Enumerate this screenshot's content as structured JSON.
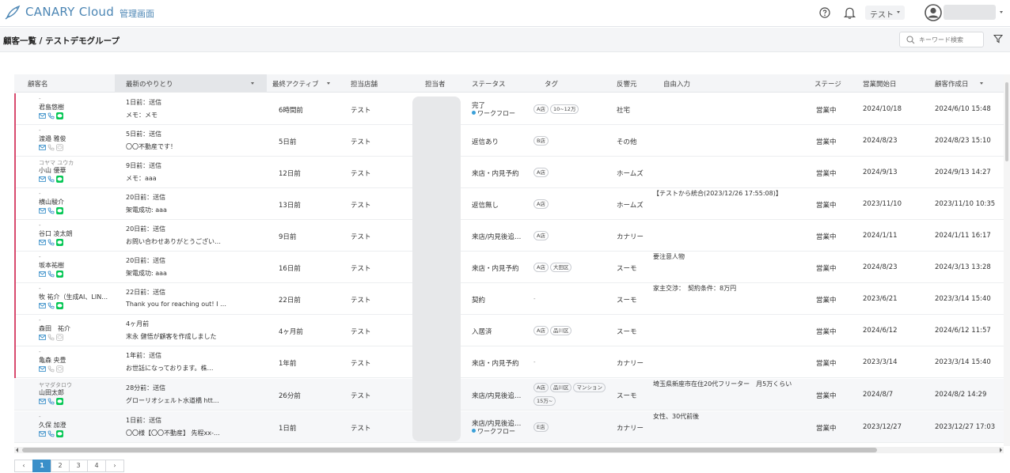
{
  "header": {
    "brand": "CANARY Cloud",
    "admin_label": "管理画面",
    "user_menu_label": "テスト",
    "accent_color": "#4c86b4"
  },
  "subheader": {
    "breadcrumb": "顧客一覧 / テストデモグループ",
    "search_placeholder": "キーワード検索"
  },
  "table": {
    "columns": [
      "顧客名",
      "最新のやりとり",
      "最終アクティブ",
      "担当店舗",
      "担当者",
      "ステータス",
      "タグ",
      "反響元",
      "自由入力",
      "ステージ",
      "営業開始日",
      "顧客作成日"
    ],
    "rows": [
      {
        "kana": "-",
        "name": "君島悠樹",
        "line1": "1日前：送信",
        "line2": "メモ：メモ",
        "active": "6時間前",
        "store": "テスト",
        "status": "完了",
        "workflow": "ワークフロー",
        "tags": [
          "A店",
          "10~12万"
        ],
        "source": "社宅",
        "free": "",
        "stage": "営業中",
        "start": "2024/10/18",
        "created": "2024/6/10 15:48",
        "line_icon": true,
        "flag": true,
        "shaded": false
      },
      {
        "kana": "-",
        "name": "渡邉 雅俊",
        "line1": "5日前：送信",
        "line2": "〇〇不動産です！",
        "active": "5日前",
        "store": "テスト",
        "status": "返信あり",
        "workflow": "",
        "tags": [
          "B店"
        ],
        "source": "その他",
        "free": "",
        "stage": "営業中",
        "start": "2024/8/23",
        "created": "2024/8/23 15:10",
        "line_icon": false,
        "flag": true,
        "shaded": false
      },
      {
        "kana": "コヤマ ユウカ",
        "name": "小山 優華",
        "line1": "9日前：送信",
        "line2": "メモ：aaa",
        "active": "12日前",
        "store": "テスト",
        "status": "来店・内見予約",
        "workflow": "",
        "tags": [
          "A店"
        ],
        "source": "ホームズ",
        "free": "",
        "stage": "営業中",
        "start": "2024/9/13",
        "created": "2024/9/13 14:27",
        "line_icon": true,
        "flag": true,
        "shaded": false
      },
      {
        "kana": "-",
        "name": "横山駿介",
        "line1": "20日前：送信",
        "line2": "架電成功: aaa",
        "active": "13日前",
        "store": "テスト",
        "status": "返信無し",
        "workflow": "",
        "tags": [
          "A店"
        ],
        "source": "ホームズ",
        "free": "【テストから統合(2023/12/26 17:55:08)】",
        "stage": "営業中",
        "start": "2023/11/10",
        "created": "2023/11/10 10:35",
        "line_icon": true,
        "flag": true,
        "shaded": false
      },
      {
        "kana": "-",
        "name": "谷口 凌太朗",
        "line1": "20日前：送信",
        "line2": "お問い合わせありがとうござい…",
        "active": "9日前",
        "store": "テスト",
        "status": "来店/内見後追…",
        "workflow": "",
        "tags": [
          "A店"
        ],
        "source": "カナリー",
        "free": "",
        "stage": "営業中",
        "start": "2024/1/11",
        "created": "2024/1/11 16:17",
        "line_icon": true,
        "flag": true,
        "shaded": false
      },
      {
        "kana": "-",
        "name": "坂本祐樹",
        "line1": "20日前：送信",
        "line2": "架電成功: aaa",
        "active": "16日前",
        "store": "テスト",
        "status": "来店・内見予約",
        "workflow": "",
        "tags": [
          "A店",
          "大田区"
        ],
        "source": "スーモ",
        "free": "要注意人物",
        "stage": "営業中",
        "start": "2024/8/23",
        "created": "2024/3/13 13:28",
        "line_icon": true,
        "flag": true,
        "shaded": false
      },
      {
        "kana": "-",
        "name": "牧 祐介（生成AI、LIN…",
        "line1": "22日前：送信",
        "line2": "Thank you for reaching out! I …",
        "active": "22日前",
        "store": "テスト",
        "status": "契約",
        "workflow": "",
        "tags": [],
        "source": "スーモ",
        "free": "家主交渉：　契約条件：8万円",
        "stage": "営業中",
        "start": "2023/6/21",
        "created": "2023/3/14 15:40",
        "line_icon": true,
        "flag": true,
        "shaded": false
      },
      {
        "kana": "-",
        "name": "森田　祐介",
        "line1": "4ヶ月前",
        "line2": "末永 健悟が顧客を作成しました",
        "active": "4ヶ月前",
        "store": "テスト",
        "status": "入居済",
        "workflow": "",
        "tags": [
          "A店",
          "品川区"
        ],
        "source": "スーモ",
        "free": "",
        "stage": "営業中",
        "start": "2024/6/12",
        "created": "2024/6/12 11:57",
        "line_icon": false,
        "flag": true,
        "shaded": false
      },
      {
        "kana": "-",
        "name": "亀森 央豊",
        "line1": "1年前：送信",
        "line2": "お世話になっております。株…",
        "active": "1年前",
        "store": "テスト",
        "status": "来店・内見予約",
        "workflow": "",
        "tags": [],
        "source": "カナリー",
        "free": "",
        "stage": "営業中",
        "start": "2023/3/14",
        "created": "2023/3/14 15:40",
        "line_icon": false,
        "flag": true,
        "shaded": false
      },
      {
        "kana": "ヤマダタロウ",
        "name": "山田太郎",
        "line1": "28分前：送信",
        "line2": "グローリオシェルト水道橋 htt…",
        "active": "26分前",
        "store": "テスト",
        "status": "来店/内見後追…",
        "workflow": "",
        "tags": [
          "A店",
          "品川区",
          "マンション",
          "15万~"
        ],
        "source": "スーモ",
        "free": "埼玉県新座市在住20代フリーター　月5万くらい",
        "stage": "営業中",
        "start": "2024/8/7",
        "created": "2024/8/2 14:29",
        "line_icon": true,
        "flag": false,
        "shaded": true
      },
      {
        "kana": "-",
        "name": "久保 加澄",
        "line1": "1日前：送信",
        "line2": "〇〇様【〇〇不動産】 先程xx-…",
        "active": "1日前",
        "store": "テスト",
        "status": "来店/内見後追…",
        "workflow": "ワークフロー",
        "tags": [
          "E店"
        ],
        "source": "カナリー",
        "free": "女性、30代前後",
        "stage": "営業中",
        "start": "2023/12/27",
        "created": "2023/12/27 17:03",
        "line_icon": true,
        "flag": false,
        "shaded": true
      }
    ],
    "empty_tag_placeholder": "-"
  },
  "pagination": {
    "prev": "‹",
    "pages": [
      "1",
      "2",
      "3",
      "4"
    ],
    "active_page": "1",
    "next": "›"
  }
}
